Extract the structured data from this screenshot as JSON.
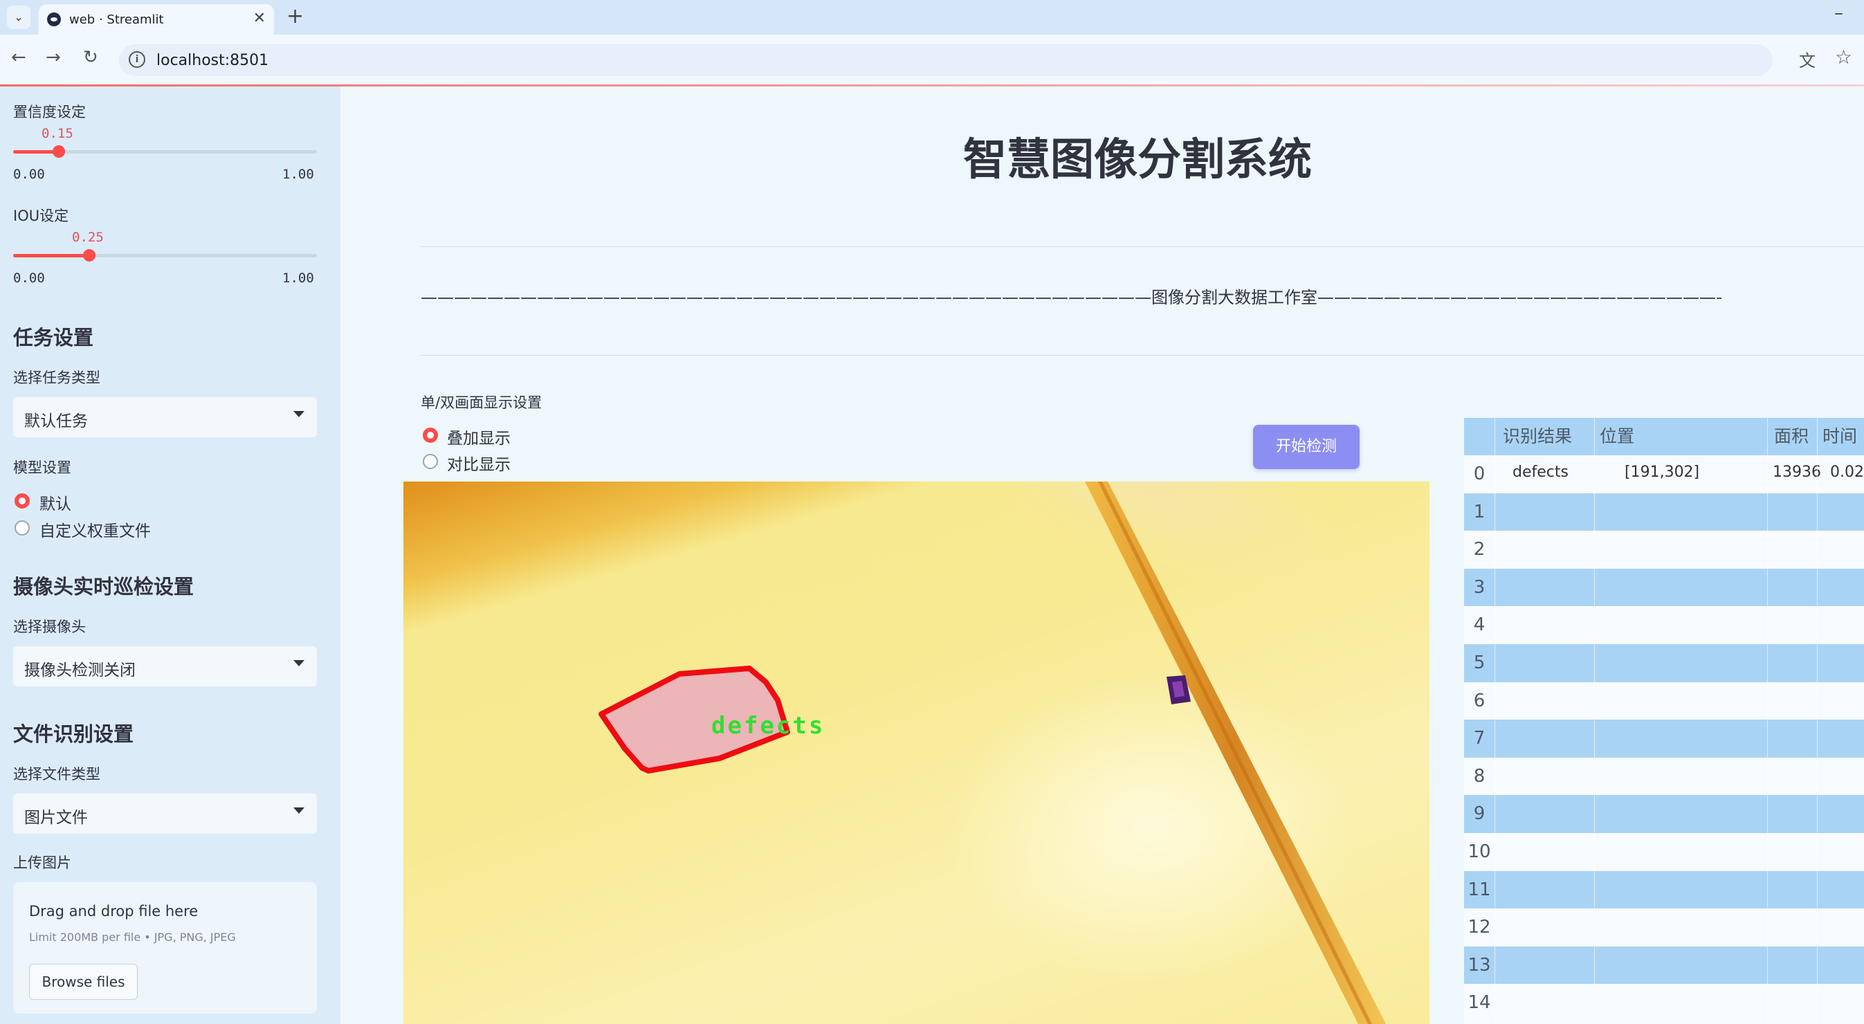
{
  "browser": {
    "tab_title": "web · Streamlit",
    "tab_close": "✕",
    "new_tab": "+",
    "minimize": "–",
    "url": "localhost:8501"
  },
  "sidebar": {
    "confidence_label": "置信度设定",
    "confidence_value": "0.15",
    "confidence_fraction": 0.15,
    "confidence_min": "0.00",
    "confidence_max": "1.00",
    "iou_label": "IOU设定",
    "iou_value": "0.25",
    "iou_fraction": 0.25,
    "iou_min": "0.00",
    "iou_max": "1.00",
    "task_heading": "任务设置",
    "task_type_label": "选择任务类型",
    "task_type_value": "默认任务",
    "model_label": "模型设置",
    "model_options": [
      "默认",
      "自定义权重文件"
    ],
    "model_selected": "默认",
    "camera_heading": "摄像头实时巡检设置",
    "camera_label": "选择摄像头",
    "camera_value": "摄像头检测关闭",
    "file_heading": "文件识别设置",
    "file_type_label": "选择文件类型",
    "file_type_value": "图片文件",
    "upload_label": "上传图片",
    "upload_title": "Drag and drop file here",
    "upload_limit": "Limit 200MB per file • JPG, PNG, JPEG",
    "browse_button": "Browse files"
  },
  "main": {
    "title": "智慧图像分割系统",
    "studio_line": "————————————————————————————————————————————图像分割大数据工作室————————————————————————————————————————————",
    "display_label": "单/双画面显示设置",
    "display_options": [
      "叠加显示",
      "对比显示"
    ],
    "display_selected": "叠加显示",
    "start_button": "开始检测",
    "detection_label": "defects"
  },
  "table": {
    "headers": [
      "识别结果",
      "位置",
      "面积",
      "时间"
    ],
    "rows": [
      {
        "idx": "0",
        "result": "defects",
        "position": "[191,302]",
        "area": "13936",
        "time": "0.02"
      },
      {
        "idx": "1"
      },
      {
        "idx": "2"
      },
      {
        "idx": "3"
      },
      {
        "idx": "4"
      },
      {
        "idx": "5"
      },
      {
        "idx": "6"
      },
      {
        "idx": "7"
      },
      {
        "idx": "8"
      },
      {
        "idx": "9"
      },
      {
        "idx": "10"
      },
      {
        "idx": "11"
      },
      {
        "idx": "12"
      },
      {
        "idx": "13"
      },
      {
        "idx": "14"
      }
    ]
  },
  "colors": {
    "accent": "#ff4b4b",
    "button": "#8d8ef2",
    "sidebar_bg": "#dcebf8",
    "table_stripe": "#a9d3f5",
    "mask_outline": "#ee0c12",
    "label_text": "#2ee12e"
  }
}
